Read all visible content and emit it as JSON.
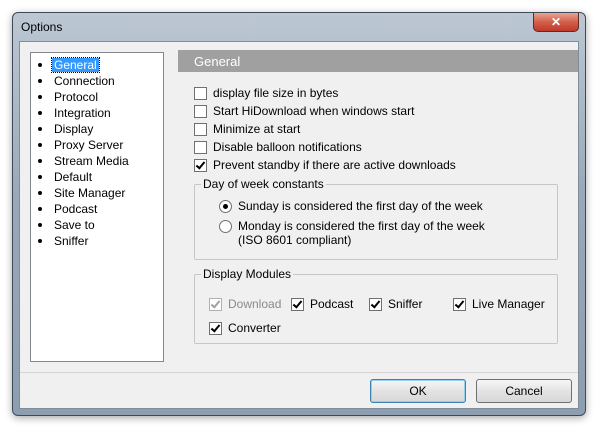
{
  "window": {
    "title": "Options",
    "close_symbol": "✕"
  },
  "nav": {
    "items": [
      {
        "label": "General",
        "selected": true
      },
      {
        "label": "Connection"
      },
      {
        "label": "Protocol"
      },
      {
        "label": "Integration"
      },
      {
        "label": "Display"
      },
      {
        "label": "Proxy Server"
      },
      {
        "label": "Stream Media"
      },
      {
        "label": "Default"
      },
      {
        "label": "Site Manager"
      },
      {
        "label": "Podcast"
      },
      {
        "label": "Save to"
      },
      {
        "label": "Sniffer"
      }
    ]
  },
  "panel": {
    "header": "General",
    "options": [
      {
        "label": "display file size in bytes",
        "checked": false
      },
      {
        "label": "Start HiDownload when windows start",
        "checked": false
      },
      {
        "label": "Minimize at start",
        "checked": false
      },
      {
        "label": "Disable balloon notifications",
        "checked": false
      },
      {
        "label": "Prevent standby if there are active downloads",
        "checked": true
      }
    ],
    "day_of_week": {
      "title": "Day of week constants",
      "sunday": "Sunday is considered the first day of the week",
      "monday": "Monday is considered the first day of the week",
      "monday_note": "(ISO 8601 compliant)",
      "selected": "sunday"
    },
    "modules": {
      "title": "Display Modules",
      "download": "Download",
      "podcast": "Podcast",
      "sniffer": "Sniffer",
      "live_manager": "Live Manager",
      "converter": "Converter"
    }
  },
  "buttons": {
    "ok": "OK",
    "cancel": "Cancel"
  }
}
